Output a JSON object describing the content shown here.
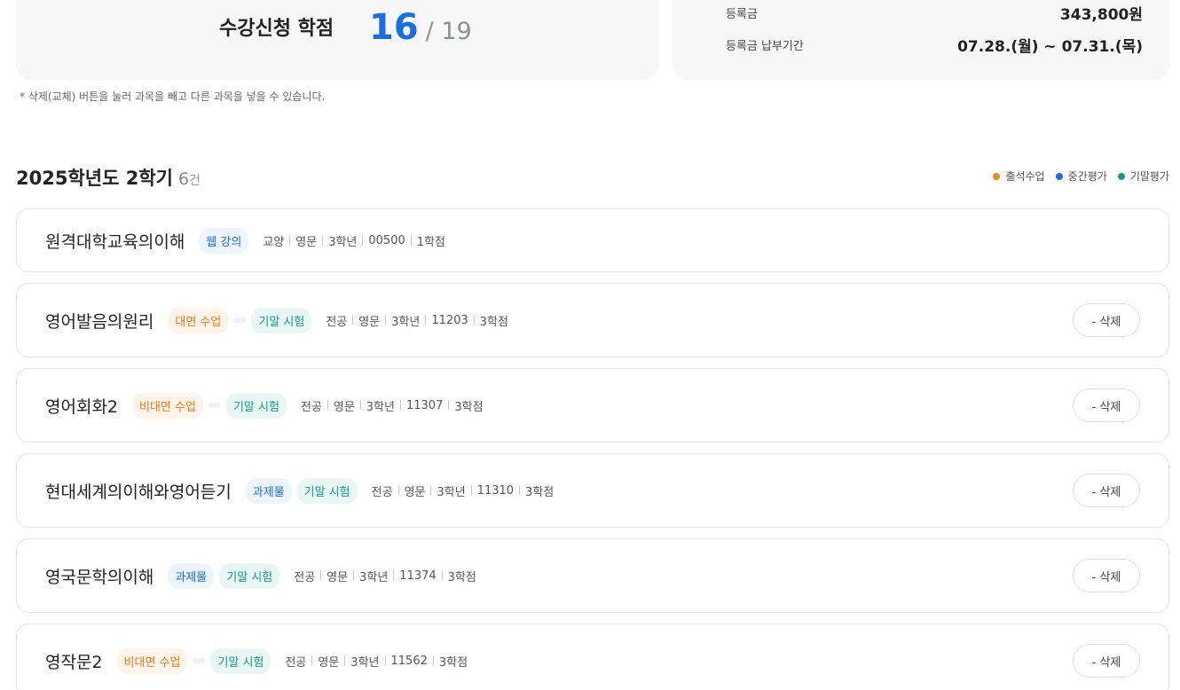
{
  "credit_summary": {
    "label": "수강신청 학점",
    "current": "16",
    "max": "/ 19"
  },
  "tuition": {
    "fee_label": "등록금",
    "fee_value": "343,800원",
    "period_label": "등록금 납부기간",
    "period_value": "07.28.(월) ~ 07.31.(목)"
  },
  "notice": "* 삭제(교체) 버튼을 눌러 과목을 빼고 다른 과목을 넣을 수 있습니다.",
  "section": {
    "title": "2025학년도 2학기",
    "count": "6",
    "count_unit": "건"
  },
  "legend": [
    {
      "label": "출석수업",
      "color": "#f08a1c"
    },
    {
      "label": "중간평가",
      "color": "#1a6fe0"
    },
    {
      "label": "기말평가",
      "color": "#179a86"
    }
  ],
  "delete_label": "- 삭제",
  "courses": [
    {
      "name": "원격대학교육의이해",
      "badges": [
        {
          "text": "웹 강의",
          "tone": "blue"
        }
      ],
      "meta": [
        "교양",
        "영문",
        "3학년",
        "00500",
        "1학점"
      ],
      "deletable": false
    },
    {
      "name": "영어발음의원리",
      "badges": [
        {
          "text": "대면 수업",
          "tone": "orange"
        },
        {
          "text": "기말 시험",
          "tone": "teal"
        }
      ],
      "meta": [
        "전공",
        "영문",
        "3학년",
        "11203",
        "3학점"
      ],
      "deletable": true
    },
    {
      "name": "영어회화2",
      "badges": [
        {
          "text": "비대면 수업",
          "tone": "orange"
        },
        {
          "text": "기말 시험",
          "tone": "teal"
        }
      ],
      "meta": [
        "전공",
        "영문",
        "3학년",
        "11307",
        "3학점"
      ],
      "deletable": true
    },
    {
      "name": "현대세계의이해와영어듣기",
      "badges": [
        {
          "text": "과제물",
          "tone": "blue"
        },
        {
          "text": "기말 시험",
          "tone": "teal"
        }
      ],
      "meta": [
        "전공",
        "영문",
        "3학년",
        "11310",
        "3학점"
      ],
      "deletable": true
    },
    {
      "name": "영국문학의이해",
      "badges": [
        {
          "text": "과제물",
          "tone": "blue"
        },
        {
          "text": "기말 시험",
          "tone": "teal"
        }
      ],
      "meta": [
        "전공",
        "영문",
        "3학년",
        "11374",
        "3학점"
      ],
      "deletable": true
    },
    {
      "name": "영작문2",
      "badges": [
        {
          "text": "비대면 수업",
          "tone": "orange"
        },
        {
          "text": "기말 시험",
          "tone": "teal"
        }
      ],
      "meta": [
        "전공",
        "영문",
        "3학년",
        "11562",
        "3학점"
      ],
      "deletable": true
    }
  ]
}
